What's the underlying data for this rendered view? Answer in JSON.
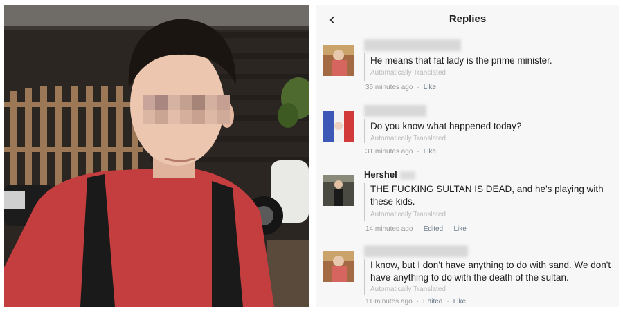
{
  "header": {
    "title": "Replies",
    "back_icon": "‹"
  },
  "comments": [
    {
      "name": "",
      "text": "He means that fat lady is the prime minister.",
      "translated": "Automatically Translated",
      "time": "36 minutes ago",
      "edited": "",
      "like": "Like"
    },
    {
      "name": "",
      "text": "Do you know what happened today?",
      "translated": "Automatically Translated",
      "time": "31 minutes ago",
      "edited": "",
      "like": "Like"
    },
    {
      "name": "Hershel",
      "text": "THE FUCKING SULTAN IS DEAD, and he's playing with these kids.",
      "translated": "Automatically Translated",
      "time": "14 minutes ago",
      "edited": "Edited",
      "like": "Like"
    },
    {
      "name": "",
      "text": "I know, but I don't have anything to do with sand. We don't have anything to do with the death of the sultan.",
      "translated": "Automatically Translated",
      "time": "11 minutes ago",
      "edited": "Edited",
      "like": "Like"
    }
  ]
}
